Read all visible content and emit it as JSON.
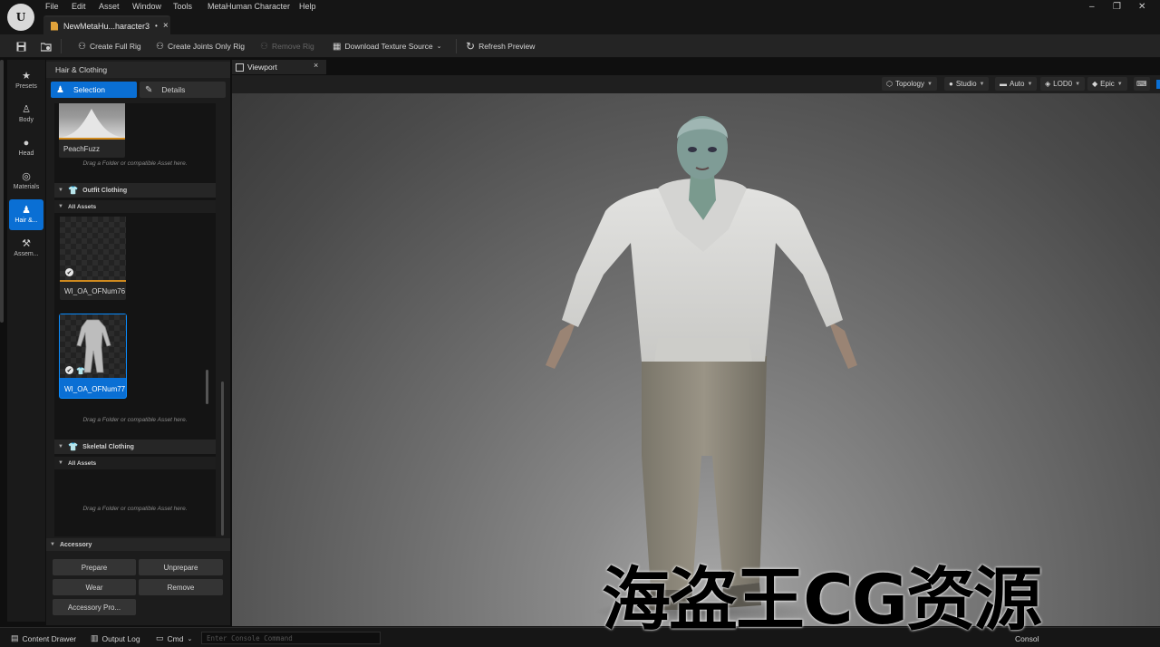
{
  "app": {
    "logo_text": "U",
    "menu": [
      "File",
      "Edit",
      "Asset",
      "Window",
      "Tools",
      "MetaHuman Character",
      "Help"
    ],
    "document_tab": "NewMetaHu...haracter3",
    "document_tab_modified": "•",
    "document_tab_close": "×",
    "window_controls": [
      "–",
      "❐",
      "✕"
    ]
  },
  "toolbar": {
    "create_full_rig": "Create Full Rig",
    "create_joints_only_rig": "Create Joints Only Rig",
    "remove_rig": "Remove Rig",
    "download_texture_source": "Download Texture Source",
    "refresh_preview": "Refresh Preview"
  },
  "sidebar": {
    "items": [
      {
        "label": "Presets",
        "icon": "star-icon"
      },
      {
        "label": "Body",
        "icon": "body-icon"
      },
      {
        "label": "Head",
        "icon": "head-icon"
      },
      {
        "label": "Materials",
        "icon": "materials-icon"
      },
      {
        "label": "Hair &...",
        "icon": "hair-clothing-icon"
      },
      {
        "label": "Assem...",
        "icon": "hammer-icon"
      }
    ],
    "active_index": 4
  },
  "panel": {
    "title": "Hair & Clothing",
    "tabs": {
      "selection": "Selection",
      "details": "Details"
    },
    "groom_asset": {
      "name": "PeachFuzz"
    },
    "drop_hint": "Drag a Folder or compatible Asset here.",
    "outfit_clothing": {
      "header": "Outfit Clothing",
      "subheader": "All Assets",
      "assets": [
        {
          "name": "WI_OA_OFNum76",
          "selected": false
        },
        {
          "name": "WI_OA_OFNum77",
          "selected": true
        }
      ]
    },
    "skeletal_clothing": {
      "header": "Skeletal Clothing",
      "subheader": "All Assets"
    },
    "accessory": {
      "header": "Accessory",
      "buttons": {
        "prepare": "Prepare",
        "unprepare": "Unprepare",
        "wear": "Wear",
        "remove": "Remove",
        "accessory_pro": "Accessory Pro..."
      }
    }
  },
  "viewport": {
    "tab_label": "Viewport",
    "tab_close": "×",
    "dropdowns": {
      "topology": "Topology",
      "studio": "Studio",
      "auto": "Auto",
      "lod": "LOD0",
      "quality": "Epic"
    }
  },
  "statusbar": {
    "content_drawer": "Content Drawer",
    "output_log": "Output Log",
    "cmd": "Cmd",
    "console_placeholder": "Enter Console Command",
    "right_label": "Consol"
  },
  "watermark": "海盗王CG资源",
  "colors": {
    "accent": "#0a6fd4",
    "asset_underline": "#d08a1e",
    "background": "#1c1c1c"
  }
}
